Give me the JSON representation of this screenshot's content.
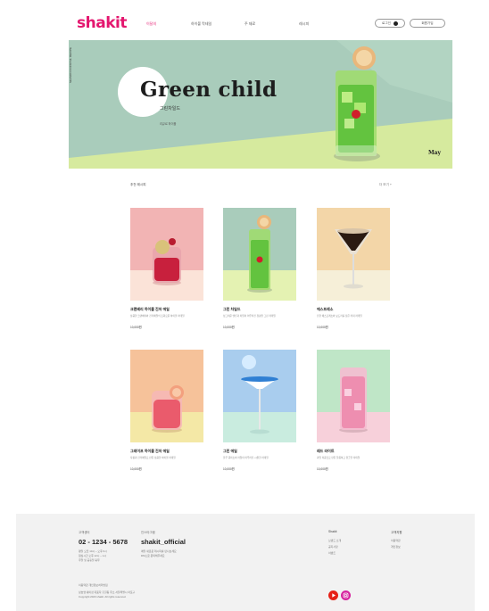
{
  "brand": {
    "logo": "shakit"
  },
  "nav": [
    {
      "label": "이달의"
    },
    {
      "label": "하이볼 칵테일"
    },
    {
      "label": "주 재료"
    },
    {
      "label": "레시피"
    }
  ],
  "header_buttons": {
    "login": "로그인",
    "signup": "회원가입"
  },
  "hero": {
    "title": "Green child",
    "subtitle": "그린차일드",
    "meta": "리큐르 하이볼",
    "month": "May",
    "vertical_text": "SEASON COCKTAIL RECIPE"
  },
  "section": {
    "title": "추천 레시피",
    "more": "더 보기 +"
  },
  "cards": [
    {
      "name": "크랜베리 하이볼 진저 에일",
      "desc": "상큼한 크랜베리와 진저에일의 조화로운 하이볼 칵테일",
      "price": "10,000원",
      "bg": "#f2b4b4",
      "floor": "#fbe3d8"
    },
    {
      "name": "그린 차일드",
      "desc": "싱그러운 멜론과 라임이 어우러진 청량한 그린 칵테일",
      "price": "10,000원",
      "bg": "#a9ccbb",
      "floor": "#e4f2b2"
    },
    {
      "name": "에스프레소",
      "desc": "진한 에스프레소와 보드카를 담은 커피 칵테일",
      "price": "10,000원",
      "bg": "#f3d6a8",
      "floor": "#f6efd8"
    },
    {
      "name": "그레이프 하이볼 진저 에일",
      "desc": "자몽과 진저에일로 만든 상큼한 하이볼 칵테일",
      "price": "10,000원",
      "bg": "#f6c29a",
      "floor": "#f4e8a6"
    },
    {
      "name": "그린 에일",
      "desc": "블루 큐라소와 라임이 어우러진 시원한 칵테일",
      "price": "10,000원",
      "bg": "#a9cdee",
      "floor": "#c9ecdf"
    },
    {
      "name": "레드 라이트",
      "desc": "과일 리큐르로 만든 달콤하고 향긋한 칵테일",
      "price": "10,000원",
      "bg": "#bfe6c7",
      "floor": "#f7d0da"
    }
  ],
  "footer": {
    "cs_label": "고객센터",
    "phone": "02 - 1234 - 5678",
    "hours": [
      "평일 오전 10시 ~ 오후 6시",
      "점심시간 오후 12시 ~ 1시",
      "주말 및 공휴일 휴무"
    ],
    "insta_label": "인스타그램",
    "insta": "shakit_official",
    "insta_desc": [
      "매일 새로운 레시피를 만나보세요",
      "DM으로 문의해주세요"
    ],
    "col1_title": "Shakit",
    "col1_items": [
      "브랜드 소개",
      "공지사항",
      "이벤트"
    ],
    "col2_title": "고객지원",
    "col2_items": [
      "이용약관",
      "개인정보"
    ],
    "policy": "이용약관    개인정보처리방침",
    "copyright": [
      "상호명 쉐이킷 대표자 홍길동 주소 서울특별시 마포구",
      "Copyright 2023 shakit. All rights reserved."
    ],
    "sns": [
      {
        "name": "youtube",
        "color": "#e62117"
      },
      {
        "name": "instagram",
        "color": "#d6249f"
      }
    ]
  }
}
